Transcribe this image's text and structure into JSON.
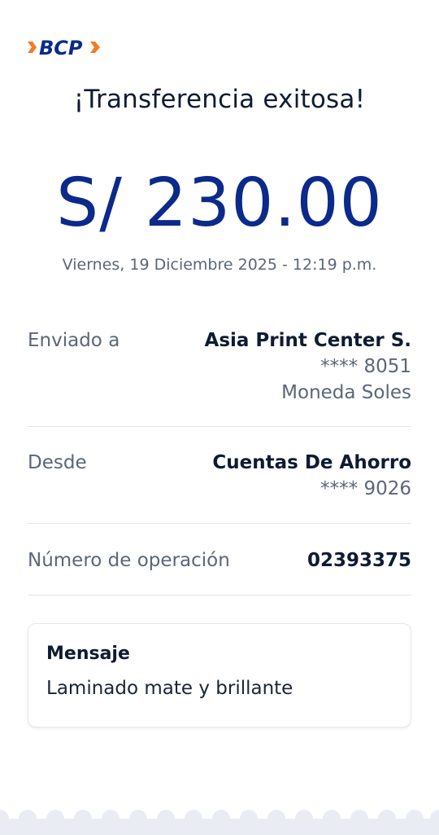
{
  "brand": {
    "logo_text": "BCP",
    "primary_color": "#0b2a8a",
    "accent_color": "#f47b20"
  },
  "receipt": {
    "title": "¡Transferencia exitosa!",
    "amount": "S/ 230.00",
    "datetime": "Viernes, 19 Diciembre 2025 - 12:19 p.m."
  },
  "details": {
    "sent_to": {
      "label": "Enviado a",
      "name": "Asia Print Center S.",
      "account": "**** 8051",
      "currency": "Moneda Soles"
    },
    "from": {
      "label": "Desde",
      "account_type": "Cuentas De Ahorro",
      "account": "**** 9026"
    },
    "operation": {
      "label": "Número de operación",
      "number": "02393375"
    }
  },
  "message": {
    "title": "Mensaje",
    "text": "Laminado mate y brillante"
  }
}
